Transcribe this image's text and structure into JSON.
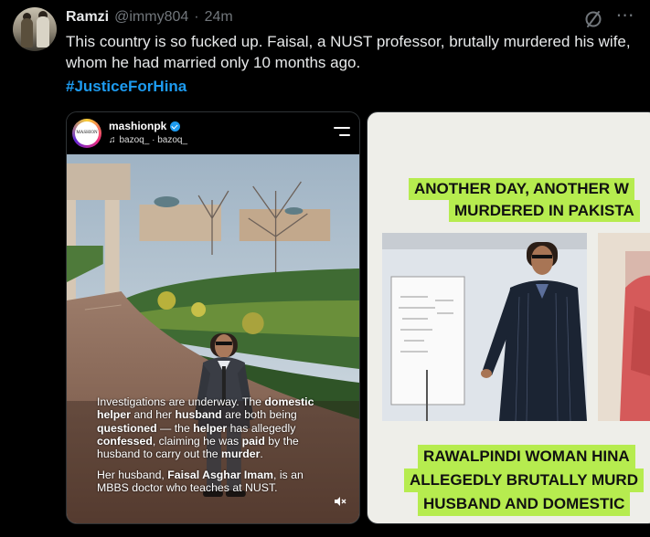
{
  "tweet": {
    "author_name": "Ramzi",
    "handle": "@immy804",
    "separator": "·",
    "time": "24m",
    "text": "This country is so fucked up. Faisal, a NUST professor, brutally murdered his wife, whom he had married only 10 months ago.",
    "hashtag": "#JusticeForHina",
    "more_icon": "⋯",
    "icons": {
      "grok": "grok-icon",
      "more": "more-icon"
    }
  },
  "media1": {
    "ig_account": "mashionpk",
    "ig_logo_text": "MASHION",
    "audio_text": "bazoq_ · bazoq_",
    "overlay_p1": {
      "s1": "Investigations are underway. The ",
      "b1": "domestic helper",
      "s2": " and her ",
      "b2": "husband",
      "s3": " are both being ",
      "b3": "questioned",
      "s4": " — the ",
      "b4": "helper",
      "s5": " has allegedly ",
      "b5": "confessed",
      "s6": ", claiming he was ",
      "b6": "paid",
      "s7": " by the husband to carry out the ",
      "b7": "murder",
      "s8": "."
    },
    "overlay_p2": {
      "s1": "Her husband, ",
      "b1": "Faisal Asghar Imam",
      "s2": ", is an MBBS doctor who teaches at NUST."
    }
  },
  "media2": {
    "headline_line1": "ANOTHER DAY, ANOTHER W",
    "headline_line2": "MURDERED IN PAKISTA",
    "bottom_line1": "RAWALPINDI WOMAN HINA",
    "bottom_line2": "ALLEGEDLY BRUTALLY MURD",
    "bottom_line3": "HUSBAND AND DOMESTIC",
    "accent_color": "#b6ec4f"
  }
}
